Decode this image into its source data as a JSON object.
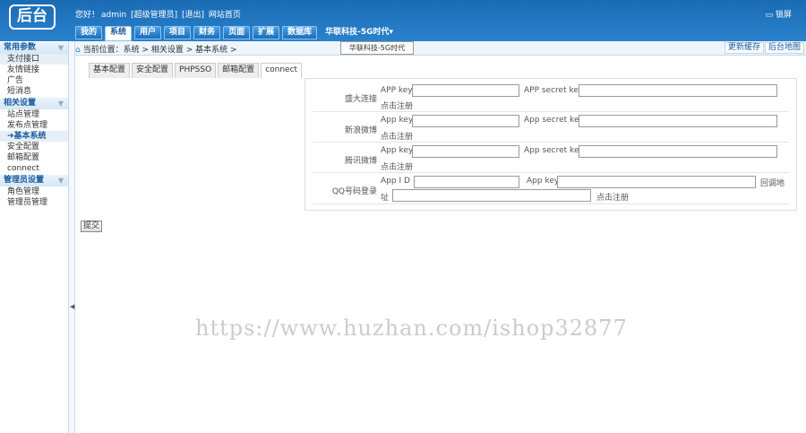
{
  "header": {
    "logo": "后台",
    "welcome_prefix": "您好！",
    "username": "admin",
    "role": "[超级管理员]",
    "logout": "[退出]",
    "site_home": "网站首页",
    "lockscreen": "锁屏",
    "lockscreen_icon": "screen-lock-icon",
    "nav_tabs": [
      "我的",
      "系统",
      "用户",
      "项目",
      "财务",
      "页面",
      "扩展",
      "数据库"
    ],
    "active_tab": "系统",
    "site_switch": "华联科技-5G时代▾",
    "site_popup": "华联科技-5G时代"
  },
  "sidebar": {
    "groups": [
      {
        "title": "常用参数",
        "items": [
          "支付接口",
          "友情链接",
          "广告",
          "短消息"
        ]
      },
      {
        "title": "相关设置",
        "items": [
          "站点管理",
          "发布点管理",
          "基本系统",
          "安全配置",
          "邮箱配置",
          "connect"
        ]
      },
      {
        "title": "管理员设置",
        "items": [
          "角色管理",
          "管理员管理"
        ]
      }
    ],
    "current_item": "基本系统"
  },
  "breadcrumb": {
    "text": "当前位置：系统 > 相关设置 > 基本系统 >",
    "update_cache": "更新缓存",
    "site_map": "后台地图"
  },
  "subtabs": [
    "基本配置",
    "安全配置",
    "PHPSSO",
    "邮箱配置",
    "connect"
  ],
  "active_subtab": "connect",
  "form": {
    "rows": [
      {
        "label": "盛大连接",
        "key_label": "APP key",
        "secret_label": "APP secret key",
        "register": "点击注册"
      },
      {
        "label": "新浪微博",
        "key_label": "App key",
        "secret_label": "App secret key",
        "register": "点击注册"
      },
      {
        "label": "腾讯微博",
        "key_label": "App key",
        "secret_label": "App secret key",
        "register": "点击注册"
      },
      {
        "label": "QQ号码登录",
        "id_label": "App I D",
        "key_label": "App key",
        "callback_label": "回调地址",
        "register": "点击注册"
      }
    ],
    "submit": "提交"
  },
  "watermark": "https://www.huzhan.com/ishop32877"
}
